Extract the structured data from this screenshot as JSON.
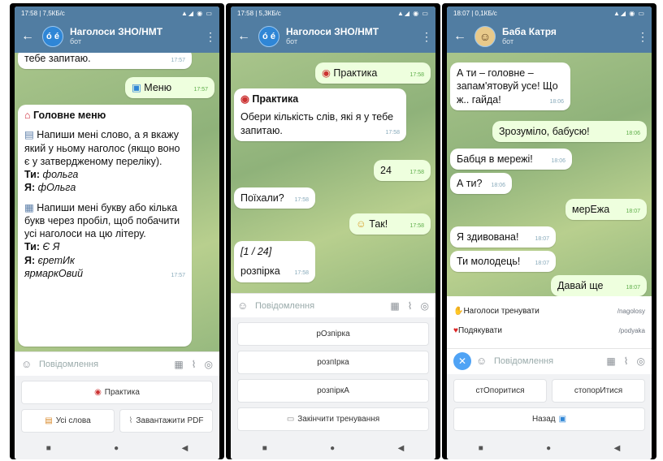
{
  "phone1": {
    "status": {
      "time": "17:58 | 7,5КБ/с",
      "icons": "▲◢ ◉ ▭"
    },
    "header": {
      "title": "Наголоси ЗНО/НМТ",
      "subtitle": "бот",
      "avatar_text": "ó é"
    },
    "messages": {
      "m1_text": "тебе запитаю.",
      "m1_time": "17:57",
      "m2_text": "Меню",
      "m2_time": "17:57",
      "m3_title": "Головне меню",
      "m3_p1": "Напиши мені слово, а я вкажу який у ньому наголос (якщо воно є у затвердженому переліку).",
      "m3_ti1": "Ти:",
      "m3_ti1_val": "фольга",
      "m3_ya1": "Я:",
      "m3_ya1_val": "фОльга",
      "m3_p2": "Напиши мені букву або кілька букв через пробіл, щоб побачити усі наголоси на цю літеру.",
      "m3_ti2": "Ти:",
      "m3_ti2_val": "Є Я",
      "m3_ya2": "Я:",
      "m3_ya2_val": "єретИк",
      "m3_ya2_val2": "ярмаркОвий",
      "m3_time": "17:57"
    },
    "composer_placeholder": "Повідомлення",
    "keyboard": {
      "practice": "Практика",
      "all_words": "Усі слова",
      "download_pdf": "Завантажити PDF"
    }
  },
  "phone2": {
    "status": {
      "time": "17:58 | 5,3КБ/с",
      "icons": "▲◢ ◉ ▭"
    },
    "header": {
      "title": "Наголоси ЗНО/НМТ",
      "subtitle": "бот",
      "avatar_text": "ó é"
    },
    "messages": {
      "m1_text": "Практика",
      "m1_time": "17:58",
      "m2_title": "Практика",
      "m2_text": "Обери кількість слів, які я у тебе запитаю.",
      "m2_time": "17:58",
      "m3_text": "24",
      "m3_time": "17:58",
      "m4_text": "Поїхали?",
      "m4_time": "17:58",
      "m5_text": "Так!",
      "m5_time": "17:58",
      "m6_counter": "[1 / 24]",
      "m6_word": "розпірка",
      "m6_time": "17:58"
    },
    "composer_placeholder": "Повідомлення",
    "keyboard": {
      "opt1": "рОзпірка",
      "opt2": "розпІрка",
      "opt3": "розпіркА",
      "finish": "Закінчити тренування"
    }
  },
  "phone3": {
    "status": {
      "time": "18:07 | 0,1КБ/с",
      "icons": "▲◢ ◉ ▭"
    },
    "header": {
      "title": "Баба Катря",
      "subtitle": "бот",
      "avatar_text": "☺"
    },
    "messages": {
      "m1_text": "А ти – головне – запам'ятовуй усе! Що ж.. гайда!",
      "m1_time": "18:06",
      "m2_text": "Зрозуміло, бабусю!",
      "m2_time": "18:06",
      "m3_text": "Бабця в мережі!",
      "m3_time": "18:06",
      "m4_text": "А ти?",
      "m4_time": "18:06",
      "m5_text": "мерЕжа",
      "m5_time": "18:07",
      "m6_text": "Я здивована!",
      "m6_time": "18:07",
      "m7_text": "Ти молодець!",
      "m7_time": "18:07",
      "m8_text": "Давай ще",
      "m8_time": "18:07"
    },
    "commands": [
      {
        "desc": "Наголоси тренувати",
        "name": "/nagolosy"
      },
      {
        "desc": "Подякувати",
        "name": "/podyaka"
      }
    ],
    "composer_placeholder": "Повідомлення",
    "keyboard": {
      "opt1": "стОпоритися",
      "opt2": "стопорИтися",
      "back": "Назад"
    }
  },
  "colors": {
    "header": "#517da2",
    "chat_bg": "#9fbf84",
    "outgoing": "#eeffde",
    "accent": "#4fa3f5"
  },
  "icons": {
    "back": "arrow-left-icon",
    "more": "kebab-menu-icon",
    "emoji": "emoji-icon",
    "attach": "paperclip-icon",
    "camera": "camera-icon"
  }
}
